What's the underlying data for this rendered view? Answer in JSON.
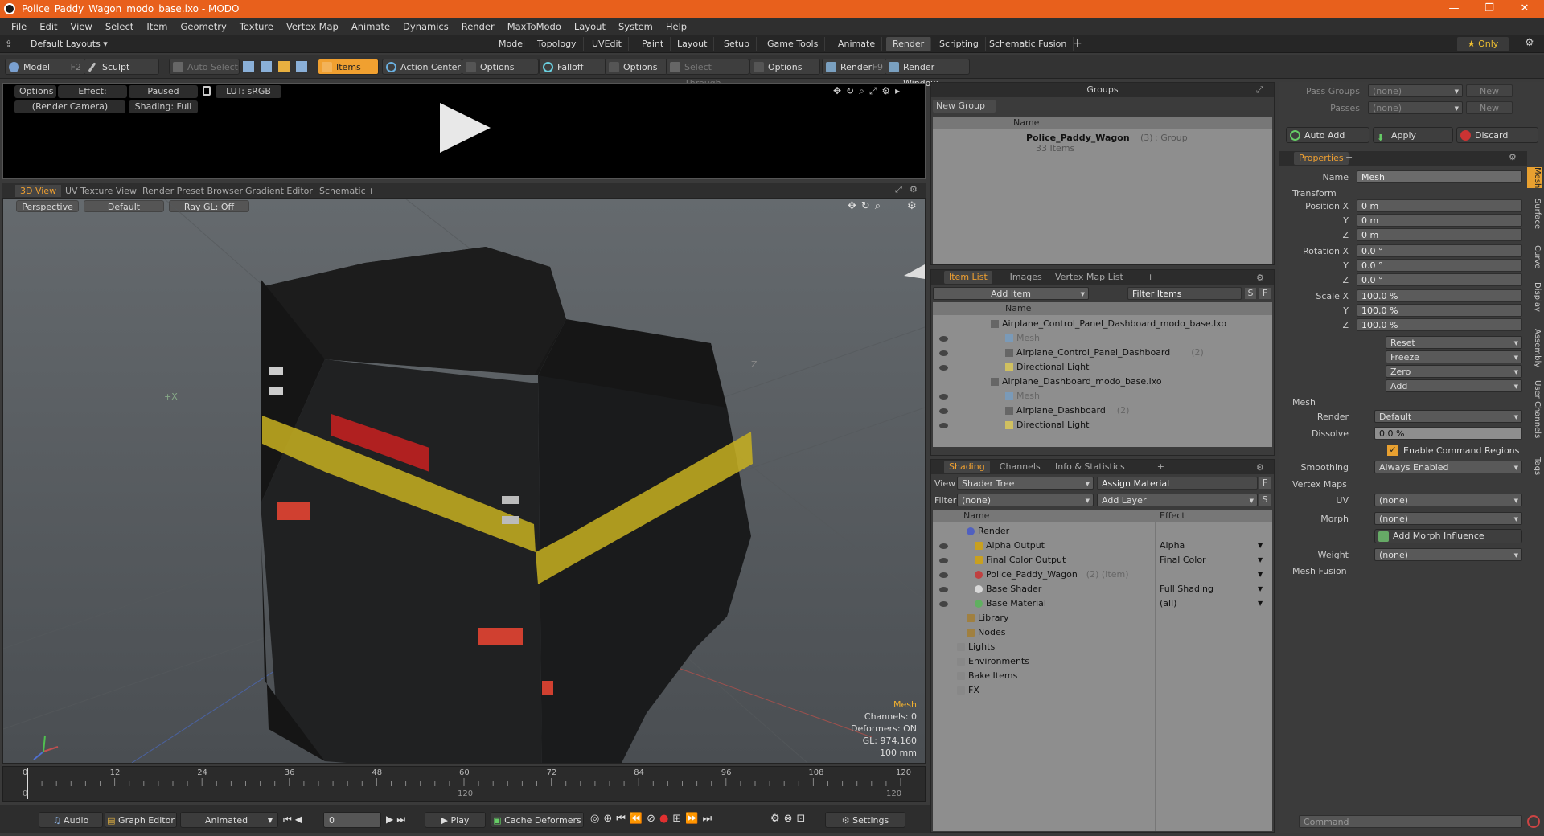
{
  "window": {
    "title": "Police_Paddy_Wagon_modo_base.lxo - MODO",
    "min": "—",
    "max": "❐",
    "close": "✕"
  },
  "menu": [
    "File",
    "Edit",
    "View",
    "Select",
    "Item",
    "Geometry",
    "Texture",
    "Vertex Map",
    "Animate",
    "Dynamics",
    "Render",
    "MaxToModo",
    "Layout",
    "System",
    "Help"
  ],
  "layouts": {
    "default_label": "Default Layouts ▾",
    "tabs": [
      "Model",
      "Topology",
      "UVEdit",
      "Paint",
      "Layout",
      "Setup",
      "Game Tools",
      "Animate",
      "Render",
      "Scripting",
      "Schematic Fusion"
    ],
    "active": "Render",
    "add": "+",
    "only": "★ Only"
  },
  "toolbar": {
    "model": "Model",
    "model_key": "F2",
    "sculpt": "Sculpt",
    "auto_select": "Auto Select",
    "items": "Items",
    "action_center": "Action Center",
    "options1": "Options",
    "falloff": "Falloff",
    "options2": "Options",
    "select_through": "Select Through",
    "options3": "Options",
    "render": "Render",
    "render_key": "F9",
    "render_window": "Render Window"
  },
  "preview": {
    "options": "Options",
    "effect": "Effect: (Shadi...",
    "paused": "Paused",
    "lut": "LUT: sRGB",
    "camera": "(Render Camera)",
    "shading": "Shading: Full"
  },
  "viewport_tabs": [
    "3D View",
    "UV Texture View",
    "Render Preset Browser",
    "Gradient Editor",
    "Schematic"
  ],
  "viewport": {
    "perspective": "Perspective",
    "default": "Default",
    "raygl": "Ray GL: Off",
    "info": {
      "type": "Mesh",
      "channels": "Channels: 0",
      "deformers": "Deformers: ON",
      "gl": "GL: 974,160",
      "size": "100 mm"
    }
  },
  "timeline": {
    "ticks": [
      "0",
      "12",
      "24",
      "36",
      "48",
      "60",
      "72",
      "84",
      "96",
      "108",
      "120"
    ],
    "sub_ticks": [
      "0",
      "120",
      "120"
    ]
  },
  "bottom": {
    "audio": "Audio",
    "graph_editor": "Graph Editor",
    "animated": "Animated",
    "frame": "0",
    "play": "Play",
    "cache": "Cache Deformers",
    "settings": "Settings"
  },
  "groups": {
    "title": "Groups",
    "new_group": "New Group",
    "col_name": "Name",
    "item_name": "Police_Paddy_Wagon",
    "item_count": "(3)",
    "item_type": ": Group",
    "item_sub": "33 Items"
  },
  "itemlist": {
    "tabs": [
      "Item List",
      "Images",
      "Vertex Map List"
    ],
    "add_item": "Add Item",
    "filter": "Filter Items",
    "s": "S",
    "f": "F",
    "col_name": "Name",
    "rows": [
      {
        "name": "Airplane_Control_Panel_Dashboard_modo_base.lxo",
        "extra": ""
      },
      {
        "name": "Mesh",
        "extra": ""
      },
      {
        "name": "Airplane_Control_Panel_Dashboard",
        "extra": "(2)"
      },
      {
        "name": "Directional Light",
        "extra": ""
      },
      {
        "name": "Airplane_Dashboard_modo_base.lxo",
        "extra": ""
      },
      {
        "name": "Mesh",
        "extra": ""
      },
      {
        "name": "Airplane_Dashboard",
        "extra": "(2)"
      },
      {
        "name": "Directional Light",
        "extra": ""
      }
    ]
  },
  "shading": {
    "tabs": [
      "Shading",
      "Channels",
      "Info & Statistics"
    ],
    "view_label": "View",
    "view_value": "Shader Tree",
    "assign": "Assign Material",
    "filter_label": "Filter",
    "filter_value": "(none)",
    "add_layer": "Add Layer",
    "f": "F",
    "s": "S",
    "col_name": "Name",
    "col_effect": "Effect",
    "rows": [
      {
        "name": "Render",
        "effect": ""
      },
      {
        "name": "Alpha Output",
        "effect": "Alpha"
      },
      {
        "name": "Final Color Output",
        "effect": "Final Color"
      },
      {
        "name": "Police_Paddy_Wagon",
        "extra": "(2) (Item)",
        "effect": ""
      },
      {
        "name": "Base Shader",
        "effect": "Full Shading"
      },
      {
        "name": "Base Material",
        "effect": "(all)"
      },
      {
        "name": "Library",
        "effect": ""
      },
      {
        "name": "Nodes",
        "effect": ""
      },
      {
        "name": "Lights",
        "effect": ""
      },
      {
        "name": "Environments",
        "effect": ""
      },
      {
        "name": "Bake Items",
        "effect": ""
      },
      {
        "name": "FX",
        "effect": ""
      }
    ]
  },
  "right": {
    "pass_groups_label": "Pass Groups",
    "pass_groups_value": "(none)",
    "new1": "New",
    "passes_label": "Passes",
    "passes_value": "(none)",
    "new2": "New",
    "auto_add": "Auto Add",
    "apply": "Apply",
    "discard": "Discard",
    "properties_tab": "Properties",
    "name_label": "Name",
    "name_value": "Mesh",
    "transform": "Transform",
    "position_x_label": "Position X",
    "y_label": "Y",
    "z_label": "Z",
    "position": [
      "0 m",
      "0 m",
      "0 m"
    ],
    "rotation_x_label": "Rotation X",
    "rotation": [
      "0.0 °",
      "0.0 °",
      "0.0 °"
    ],
    "scale_x_label": "Scale X",
    "scale": [
      "100.0 %",
      "100.0 %",
      "100.0 %"
    ],
    "reset": "Reset",
    "freeze": "Freeze",
    "zero": "Zero",
    "add": "Add",
    "mesh": "Mesh",
    "render_label": "Render",
    "render_value": "Default",
    "dissolve_label": "Dissolve",
    "dissolve_value": "0.0 %",
    "enable_cmd": "Enable Command Regions",
    "smoothing_label": "Smoothing",
    "smoothing_value": "Always Enabled",
    "vertex_maps": "Vertex Maps",
    "uv_label": "UV",
    "uv_value": "(none)",
    "morph_label": "Morph",
    "morph_value": "(none)",
    "add_morph": "Add Morph Influence",
    "weight_label": "Weight",
    "weight_value": "(none)",
    "mesh_fusion": "Mesh Fusion",
    "side_tabs": [
      "Mesh",
      "Surface",
      "Curve",
      "Display",
      "Assembly",
      "User Channels",
      "Tags"
    ],
    "command_placeholder": "Command"
  },
  "colors": {
    "accent": "#f0a030",
    "titlebar": "#e8601c"
  }
}
